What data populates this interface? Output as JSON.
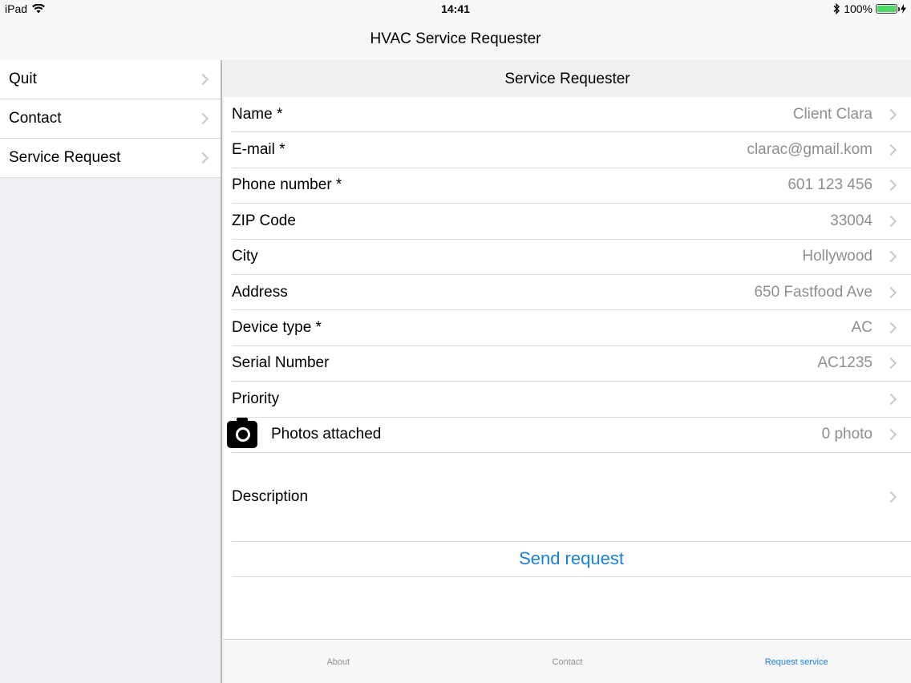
{
  "status_bar": {
    "device": "iPad",
    "time": "14:41",
    "battery": "100%",
    "battery_level": 1.0
  },
  "nav_bar": {
    "title": "HVAC Service Requester"
  },
  "sidebar": {
    "items": [
      {
        "label": "Quit"
      },
      {
        "label": "Contact"
      },
      {
        "label": "Service Request"
      }
    ]
  },
  "detail": {
    "title": "Service Requester",
    "fields": [
      {
        "label": "Name *",
        "value": "Client Clara"
      },
      {
        "label": "E-mail *",
        "value": "clarac@gmail.kom"
      },
      {
        "label": "Phone number *",
        "value": "601 123 456"
      },
      {
        "label": "ZIP Code",
        "value": "33004"
      },
      {
        "label": "City",
        "value": "Hollywood"
      },
      {
        "label": "Address",
        "value": "650 Fastfood Ave"
      },
      {
        "label": "Device type *",
        "value": "AC"
      },
      {
        "label": "Serial Number",
        "value": "AC1235"
      },
      {
        "label": "Priority",
        "value": ""
      }
    ],
    "photos": {
      "label": "Photos attached",
      "value": "0 photo",
      "icon": "camera-icon"
    },
    "description": {
      "label": "Description"
    },
    "send_label": "Send request"
  },
  "tab_bar": {
    "tabs": [
      {
        "label": "About"
      },
      {
        "label": "Contact"
      },
      {
        "label": "Request service"
      }
    ],
    "active_color": "#1a7fe0"
  }
}
